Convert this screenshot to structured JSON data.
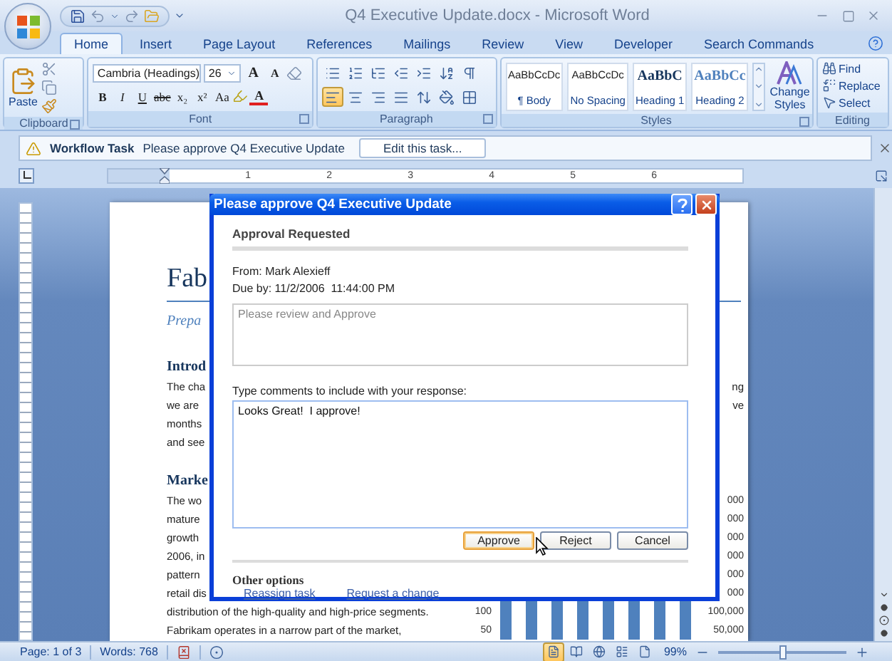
{
  "window": {
    "title": "Q4 Executive Update.docx - Microsoft Word"
  },
  "ribbon_tabs": [
    {
      "label": "Home",
      "selected": true
    },
    {
      "label": "Insert",
      "selected": false
    },
    {
      "label": "Page Layout",
      "selected": false
    },
    {
      "label": "References",
      "selected": false
    },
    {
      "label": "Mailings",
      "selected": false
    },
    {
      "label": "Review",
      "selected": false
    },
    {
      "label": "View",
      "selected": false
    },
    {
      "label": "Developer",
      "selected": false
    },
    {
      "label": "Search Commands",
      "selected": false
    }
  ],
  "ribbon": {
    "clipboard": {
      "label": "Clipboard",
      "paste": "Paste"
    },
    "font": {
      "label": "Font",
      "font_name": "Cambria (Headings)",
      "font_size": "26",
      "size_buttons": [
        "A",
        "A"
      ],
      "format_buttons": [
        "B",
        "I",
        "U",
        "abc",
        "x₂",
        "x²",
        "Aa"
      ],
      "font_color": "A"
    },
    "paragraph": {
      "label": "Paragraph",
      "alignments": [
        {
          "kind": "left",
          "selected": true
        },
        {
          "kind": "center",
          "selected": false
        },
        {
          "kind": "right",
          "selected": false
        },
        {
          "kind": "justify",
          "selected": false
        }
      ]
    },
    "styles": {
      "label": "Styles",
      "items": [
        {
          "preview": "AaBbCcDc",
          "name": "¶ Body",
          "kind": "body"
        },
        {
          "preview": "AaBbCcDc",
          "name": "No Spacing",
          "kind": "body"
        },
        {
          "preview": "AaBbC",
          "name": "Heading 1",
          "kind": "heading"
        },
        {
          "preview": "AaBbCc",
          "name": "Heading 2",
          "kind": "subheading"
        }
      ],
      "change_styles": "Change Styles"
    },
    "editing": {
      "label": "Editing",
      "items": [
        "Find",
        "Replace",
        "Select"
      ]
    }
  },
  "workflow_bar": {
    "title": "Workflow Task",
    "message": "Please approve Q4 Executive Update",
    "button": "Edit this task..."
  },
  "ruler": {
    "numbers": [
      "1",
      "2",
      "3",
      "4",
      "5",
      "6"
    ]
  },
  "page": {
    "title": "Fab",
    "subtitle": "Prepa",
    "intro": {
      "heading": "Introd",
      "lines": [
        {
          "left": "The cha",
          "right": "ng"
        },
        {
          "left": "we are",
          "right": "ve"
        },
        {
          "left": "months"
        },
        {
          "left": "and see"
        }
      ]
    },
    "market": {
      "heading": "Marke",
      "lines": [
        "The wo",
        "mature",
        "growth",
        "2006, in",
        "pattern",
        "retail dis",
        "distribution of the high-quality and high-price segments.",
        "Fabrikam operates in a narrow part of the market,"
      ]
    },
    "chart": {
      "left_labels": [
        "100",
        "50"
      ],
      "right_labels": [
        "000",
        "000",
        "000",
        "000",
        "000",
        "000",
        "100,000",
        "50,000"
      ]
    }
  },
  "dialog": {
    "title": "Please approve Q4 Executive Update",
    "heading": "Approval Requested",
    "from": "From: Mark Alexieff",
    "due": "Due by: 11/2/2006  11:44:00 PM",
    "request_message": "Please review and Approve",
    "comments_label": "Type comments to include with your response:",
    "comments": "Looks Great!  I approve!",
    "buttons": [
      {
        "label": "Approve",
        "default": true
      },
      {
        "label": "Reject",
        "default": false
      },
      {
        "label": "Cancel",
        "default": false
      }
    ],
    "other_options": {
      "heading": "Other options",
      "links": [
        "Reassign task",
        "Request a change"
      ]
    }
  },
  "status_bar": {
    "page": "Page: 1 of 3",
    "words": "Words: 768",
    "view_buttons": [
      {
        "selected": true
      },
      {
        "selected": false
      },
      {
        "selected": false
      },
      {
        "selected": false
      },
      {
        "selected": false
      }
    ],
    "zoom": "99%",
    "zoom_slider": {
      "level": 0.5
    }
  }
}
